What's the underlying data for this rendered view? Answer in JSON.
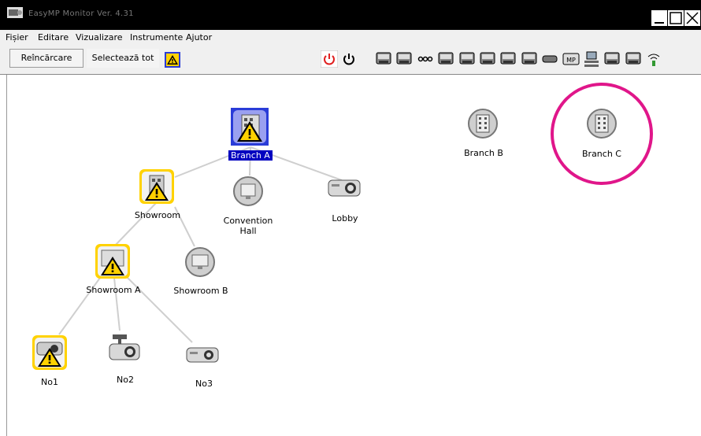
{
  "window": {
    "title": "EasyMP Monitor Ver. 4.31"
  },
  "menubar": {
    "items": [
      "Fișier",
      "Editare",
      "Vizualizare",
      "Instrumente",
      "Ajutor"
    ]
  },
  "toolbar": {
    "reload_label": "Reîncărcare",
    "select_all_label": "Selectează tot",
    "icon_buttons": [
      "power-on-icon",
      "power-off-icon",
      "source-computer1-icon",
      "source-computer2-icon",
      "source-video-icon",
      "source-s-video-icon",
      "source-component-icon",
      "source-rgb-video-icon",
      "source-dvi-icon",
      "source-hdmi-icon",
      "source-usb-icon",
      "source-mp-icon",
      "source-network-icon",
      "input-1-icon",
      "input-2-icon",
      "wireless-icon"
    ]
  },
  "tree": {
    "nodes": [
      {
        "id": "branch-a",
        "label": "Branch A",
        "kind": "building",
        "status": "warning",
        "selected": true
      },
      {
        "id": "showroom",
        "label": "Showroom",
        "kind": "building",
        "status": "warning"
      },
      {
        "id": "convention-hall",
        "label": "Convention\nHall",
        "kind": "monitor",
        "status": "normal"
      },
      {
        "id": "lobby",
        "label": "Lobby",
        "kind": "projector",
        "status": "normal"
      },
      {
        "id": "showroom-a",
        "label": "Showroom A",
        "kind": "monitor",
        "status": "warning"
      },
      {
        "id": "showroom-b",
        "label": "Showroom B",
        "kind": "monitor",
        "status": "normal"
      },
      {
        "id": "no1",
        "label": "No1",
        "kind": "projector",
        "status": "warning"
      },
      {
        "id": "no2",
        "label": "No2",
        "kind": "projector-ceiling",
        "status": "normal"
      },
      {
        "id": "no3",
        "label": "No3",
        "kind": "projector",
        "status": "normal"
      },
      {
        "id": "branch-b",
        "label": "Branch B",
        "kind": "building",
        "status": "normal"
      },
      {
        "id": "branch-c",
        "label": "Branch C",
        "kind": "building",
        "status": "normal",
        "highlighted": true
      }
    ]
  },
  "colors": {
    "warning": "#ffd200",
    "selected": "#2a3cd8",
    "highlight_circle": "#e0168a",
    "edge": "#cfcfcf"
  }
}
